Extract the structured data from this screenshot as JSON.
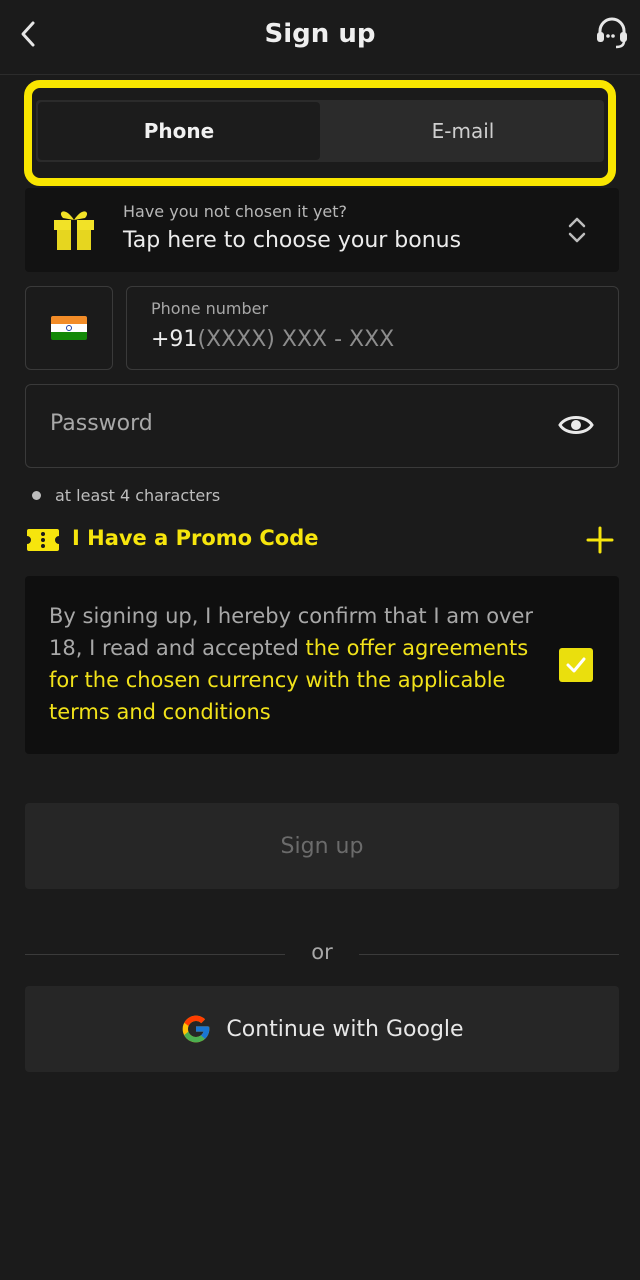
{
  "header": {
    "title": "Sign up",
    "back_icon": "chevron-left-icon",
    "support_icon": "headset-icon"
  },
  "tabs": [
    {
      "label": "Phone",
      "active": true
    },
    {
      "label": "E-mail",
      "active": false
    }
  ],
  "bonus": {
    "question": "Have you not chosen it yet?",
    "cta": "Tap here to choose your bonus",
    "icon": "gift-icon"
  },
  "phone": {
    "country_flag": "india-flag-icon",
    "label": "Phone number",
    "prefix": "+91",
    "placeholder": "(XXXX) XXX - XXX"
  },
  "password": {
    "placeholder": "Password",
    "icon": "eye-icon",
    "hint": "at least 4 characters"
  },
  "promo": {
    "label": "I Have a Promo Code",
    "icon": "ticket-icon"
  },
  "agreement": {
    "text_plain": "By signing up, I hereby confirm that I am over 18, I read and accepted ",
    "text_link": "the offer agreements for the chosen currency with the applicable terms and conditions",
    "checked": true
  },
  "actions": {
    "signup_label": "Sign up",
    "or_label": "or",
    "google_label": "Continue with Google"
  },
  "colors": {
    "accent": "#f9e600",
    "background": "#1b1b1b",
    "surface": "#262626"
  }
}
